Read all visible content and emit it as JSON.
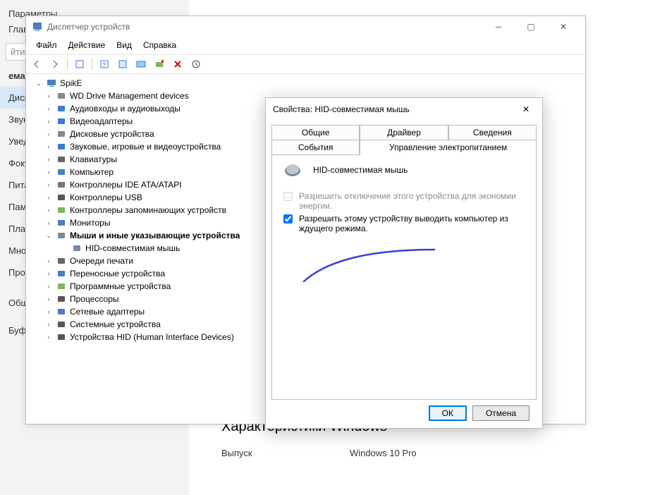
{
  "settings": {
    "sidebar_top": "Параметры",
    "sidebar_home": "Глав",
    "search_placeholder": "йти п",
    "category": "ема",
    "items": [
      "Дисп",
      "Звук",
      "Увед",
      "Фоку",
      "Пита",
      "Памя",
      "План",
      "Мног",
      "Проец"
    ],
    "extra": [
      "Общие возможности",
      "Буфер обмена"
    ],
    "spec_heading": "Характеристики Windows",
    "spec_edition_k": "Выпуск",
    "spec_edition_v": "Windows 10 Pro"
  },
  "device_manager": {
    "title": "Диспетчер устройств",
    "menu": [
      "Файл",
      "Действие",
      "Вид",
      "Справка"
    ],
    "root": "SpikE",
    "nodes": [
      {
        "label": "WD Drive Management devices",
        "icon": "gear"
      },
      {
        "label": "Аудиовходы и аудиовыходы",
        "icon": "audio"
      },
      {
        "label": "Видеоадаптеры",
        "icon": "gpu"
      },
      {
        "label": "Дисковые устройства",
        "icon": "disk"
      },
      {
        "label": "Звуковые, игровые и видеоустройства",
        "icon": "sound"
      },
      {
        "label": "Клавиатуры",
        "icon": "keyboard"
      },
      {
        "label": "Компьютер",
        "icon": "computer"
      },
      {
        "label": "Контроллеры IDE ATA/ATAPI",
        "icon": "ide"
      },
      {
        "label": "Контроллеры USB",
        "icon": "usb"
      },
      {
        "label": "Контроллеры запоминающих устройств",
        "icon": "storage"
      },
      {
        "label": "Мониторы",
        "icon": "monitor"
      },
      {
        "label": "Мыши и иные указывающие устройства",
        "icon": "mouse",
        "expanded": true,
        "children": [
          {
            "label": "HID-совместимая мышь",
            "icon": "mouse"
          }
        ]
      },
      {
        "label": "Очереди печати",
        "icon": "print"
      },
      {
        "label": "Переносные устройства",
        "icon": "portable"
      },
      {
        "label": "Программные устройства",
        "icon": "soft"
      },
      {
        "label": "Процессоры",
        "icon": "cpu"
      },
      {
        "label": "Сетевые адаптеры",
        "icon": "net"
      },
      {
        "label": "Системные устройства",
        "icon": "sys"
      },
      {
        "label": "Устройства HID (Human Interface Devices)",
        "icon": "hid"
      }
    ]
  },
  "props": {
    "title": "Свойства: HID-совместимая мышь",
    "tabs_row1": [
      "Общие",
      "Драйвер",
      "Сведения"
    ],
    "tabs_row2": [
      "События",
      "Управление электропитанием"
    ],
    "device_label": "HID-совместимая мышь",
    "cb1": "Разрешить отключение этого устройства для экономии энергии.",
    "cb2": "Разрешить этому устройству выводить компьютер из ждущего режима.",
    "ok": "ОК",
    "cancel": "Отмена"
  }
}
